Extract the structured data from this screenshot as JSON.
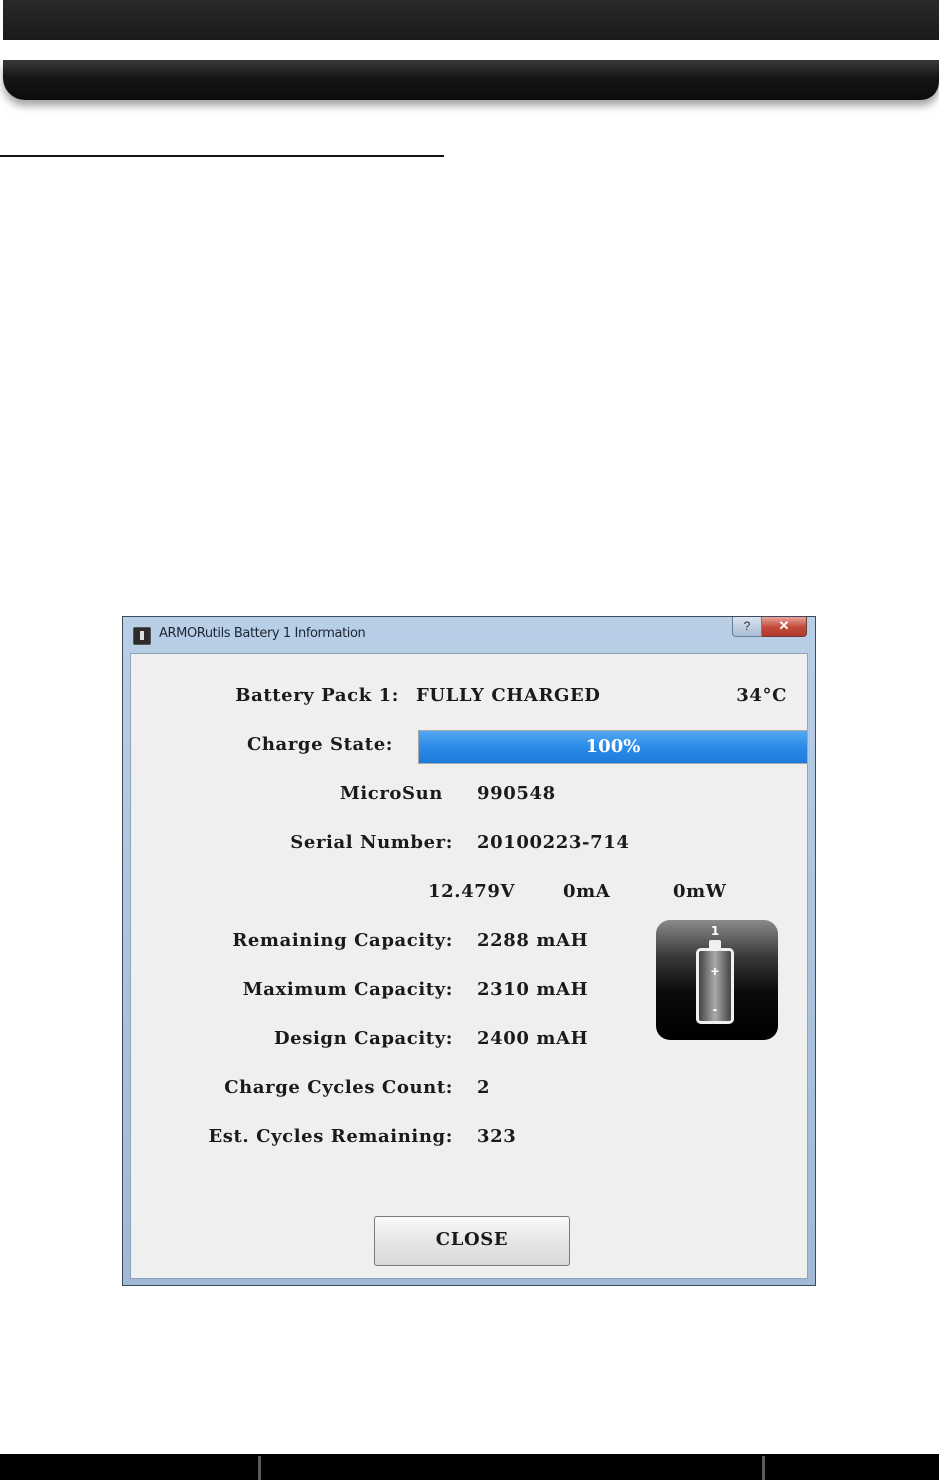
{
  "window": {
    "title": "ARMORutils Battery 1 Information",
    "help_label": "?",
    "close_label": "✕"
  },
  "battery": {
    "pack_label": "Battery Pack 1:",
    "status": "FULLY CHARGED",
    "temperature": "34°C",
    "charge_state_label": "Charge State:",
    "charge_percent_text": "100%",
    "charge_fraction": 1.0,
    "manufacturer": "MicroSun",
    "manufacturer_code": "990548",
    "serial_label": "Serial Number:",
    "serial_value": "20100223-714",
    "voltage": "12.479V",
    "current": "0mA",
    "power": "0mW",
    "remaining_label": "Remaining Capacity:",
    "remaining_value": "2288 mAH",
    "maximum_label": "Maximum Capacity:",
    "maximum_value": "2310 mAH",
    "design_label": "Design Capacity:",
    "design_value": "2400 mAH",
    "cycles_label": "Charge Cycles Count:",
    "cycles_value": "2",
    "est_label": "Est. Cycles Remaining:",
    "est_value": "323",
    "icon_number": "1",
    "icon_plus": "+",
    "icon_minus": "-"
  },
  "buttons": {
    "close": "CLOSE"
  },
  "colors": {
    "progress_fill": "#2a8ae8",
    "title_close": "#c0493a"
  }
}
